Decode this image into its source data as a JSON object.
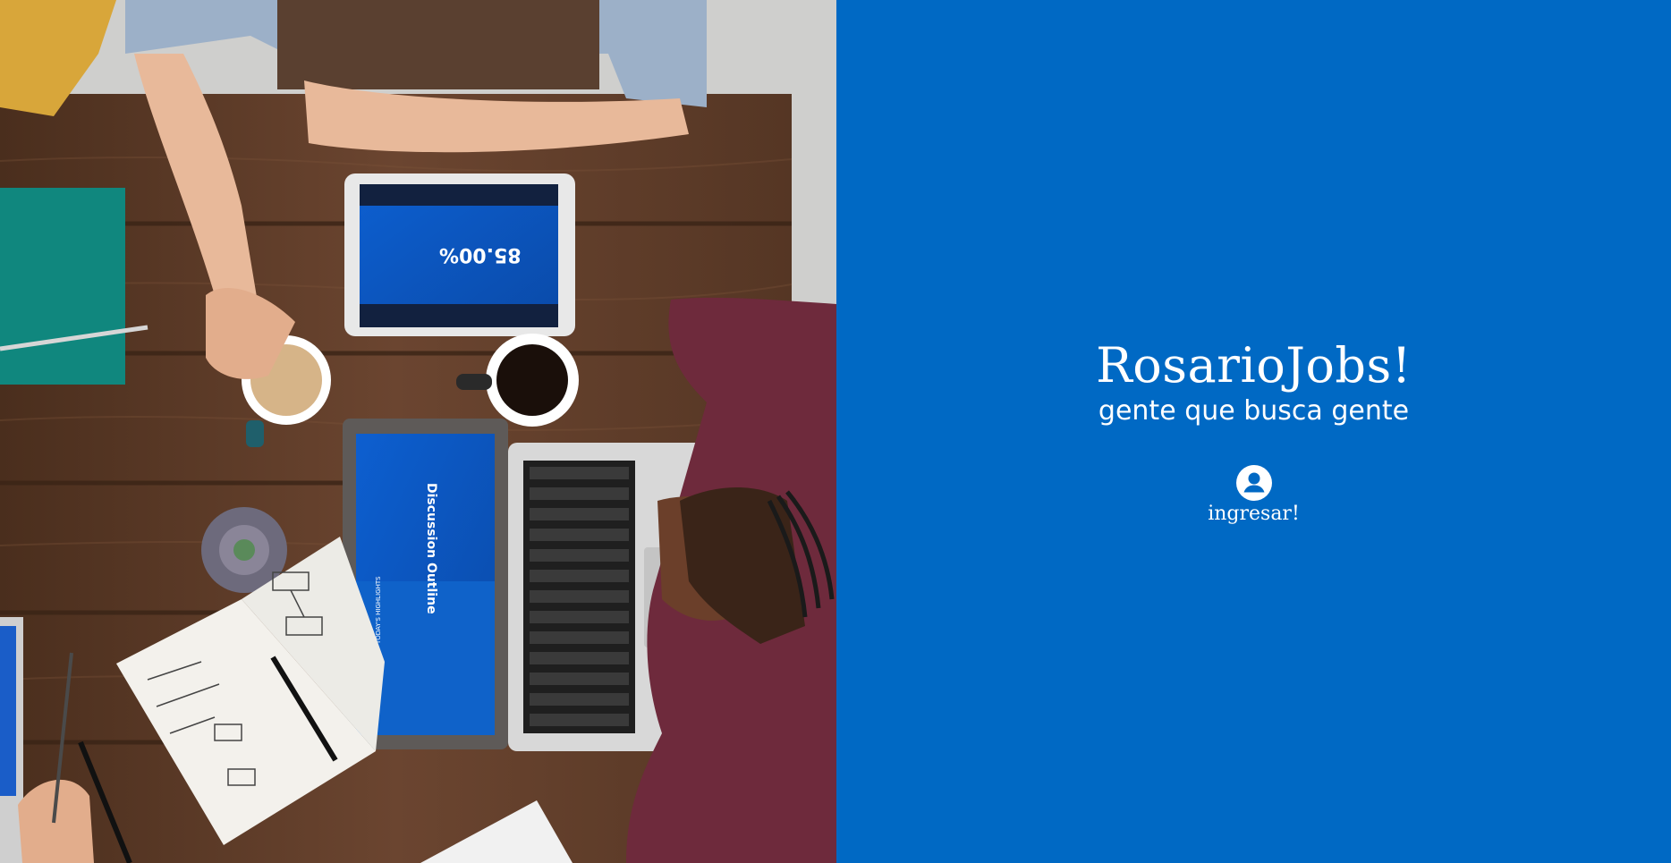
{
  "brand": {
    "title": "RosarioJobs!",
    "tagline": "gente que busca gente"
  },
  "login": {
    "label": "ingresar!",
    "icon": "user-circle-icon"
  },
  "hero": {
    "tablet_stat": "85.00%",
    "laptop_heading": "Discussion Outline",
    "laptop_subheading": "TODAY'S HIGHLIGHTS"
  },
  "colors": {
    "panel_background": "#0069c4",
    "text": "#ffffff"
  }
}
